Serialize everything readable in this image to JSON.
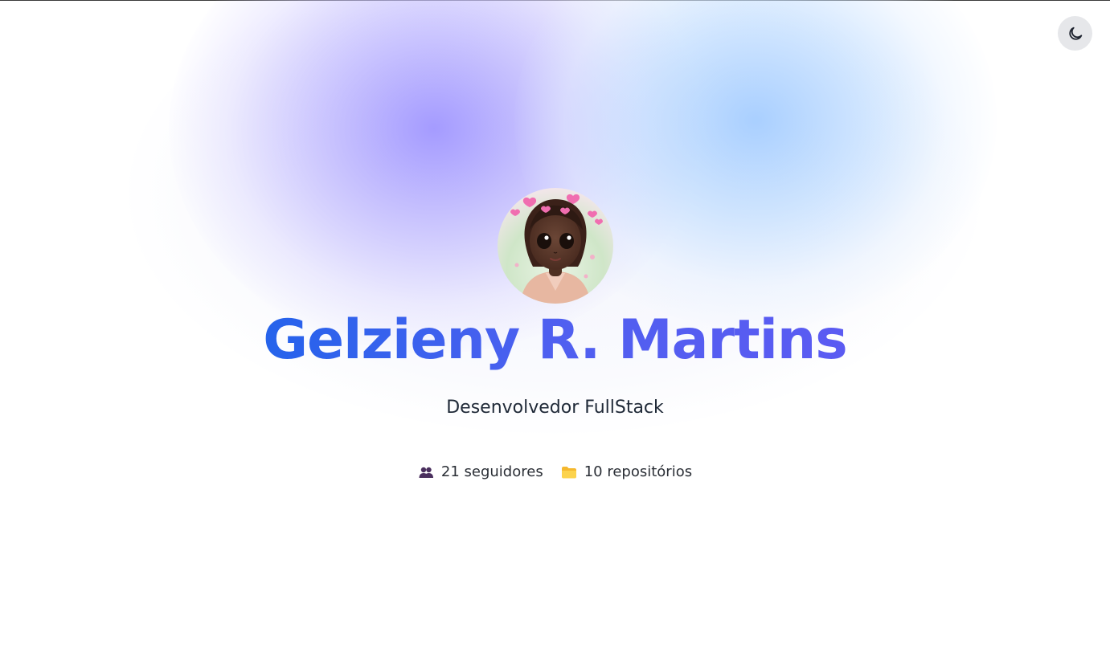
{
  "profile": {
    "name": "Gelzieny R. Martins",
    "title": "Desenvolvedor FullStack",
    "avatar_icon": "profile-avatar"
  },
  "stats": {
    "followers": {
      "icon": "people-icon",
      "label": "21 seguidores"
    },
    "repos": {
      "icon": "folder-icon",
      "label": "10 repositórios"
    }
  },
  "theme_toggle": {
    "icon": "moon-icon"
  },
  "colors": {
    "name_gradient_start": "#2563eb",
    "name_gradient_end": "#5b5bf2",
    "glow_purple": "#a89cff",
    "glow_blue": "#a5cdff",
    "toggle_bg": "#e6e7ea",
    "text": "#1f2937"
  }
}
